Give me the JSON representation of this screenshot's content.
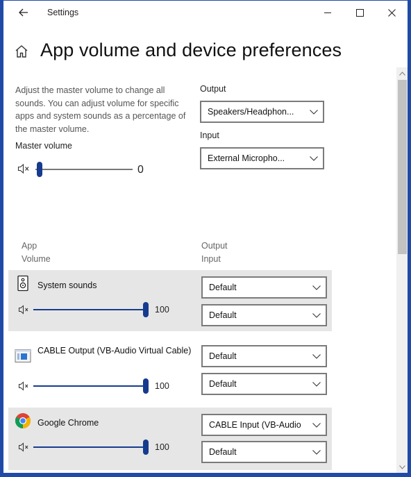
{
  "window": {
    "title": "Settings"
  },
  "page": {
    "title": "App volume and device preferences"
  },
  "description": "Adjust the master volume to change all sounds. You can adjust volume for specific apps and system sounds as a percentage of the master volume.",
  "master": {
    "label": "Master volume",
    "value": "0",
    "level_percent": 0
  },
  "output": {
    "label": "Output",
    "selected": "Speakers/Headphon..."
  },
  "input": {
    "label": "Input",
    "selected": "External Micropho..."
  },
  "columns": {
    "app": "App",
    "volume": "Volume",
    "output": "Output",
    "input": "Input"
  },
  "apps": [
    {
      "name": "System sounds",
      "icon": "speaker-icon",
      "volume": "100",
      "output": "Default",
      "input": "Default"
    },
    {
      "name": "CABLE Output (VB-Audio Virtual Cable)",
      "icon": "window-app-icon",
      "volume": "100",
      "output": "Default",
      "input": "Default"
    },
    {
      "name": "Google Chrome",
      "icon": "chrome-icon",
      "volume": "100",
      "output": "CABLE Input (VB-Audio",
      "input": "Default"
    }
  ],
  "colors": {
    "accent": "#163b8e",
    "border": "#1f4aa8",
    "row_shade": "#e6e6e6"
  }
}
